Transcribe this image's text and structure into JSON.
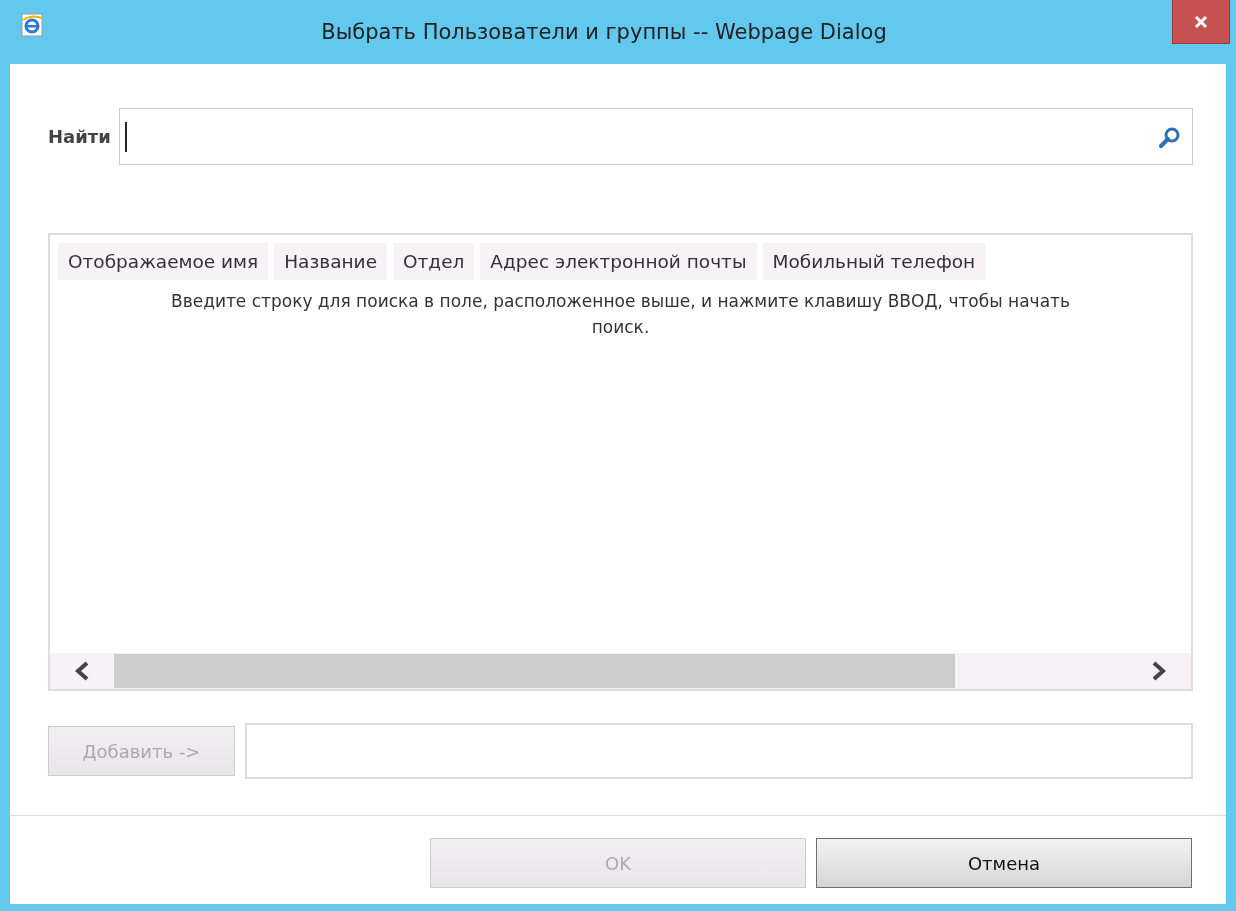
{
  "window": {
    "title": "Выбрать Пользователи и группы -- Webpage Dialog"
  },
  "search": {
    "label": "Найти"
  },
  "table": {
    "columns": [
      "Отображаемое имя",
      "Название",
      "Отдел",
      "Адрес электронной почты",
      "Мобильный телефон"
    ],
    "empty_message": "Введите строку для поиска в поле, расположенное выше, и нажмите клавишу ВВОД, чтобы начать поиск."
  },
  "add_button": {
    "label": "Добавить ->",
    "disabled": true
  },
  "buttons": [
    {
      "label": "OK",
      "disabled": true
    },
    {
      "label": "Отмена",
      "disabled": false
    }
  ]
}
